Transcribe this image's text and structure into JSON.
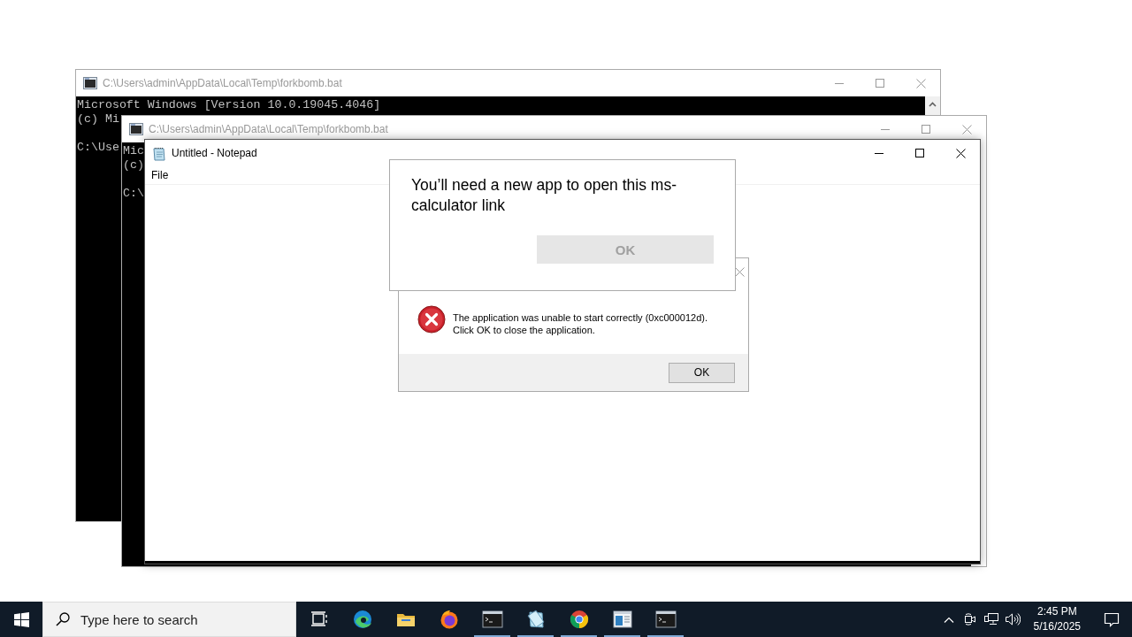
{
  "windows": [
    {
      "kind": "console",
      "title": "C:\\Users\\admin\\AppData\\Local\\Temp\\forkbomb.bat",
      "active": false,
      "lines": [
        "Microsoft Windows [Version 10.0.19045.4046]",
        "(c) Mi",
        "C:\\Use"
      ]
    },
    {
      "kind": "console",
      "title": "C:\\Users\\admin\\AppData\\Local\\Temp\\forkbomb.bat",
      "active": false,
      "lines": [
        "Mic",
        "(c)",
        "C:\\"
      ]
    },
    {
      "kind": "notepad",
      "title": "Untitled - Notepad",
      "active": true,
      "menu": [
        "File"
      ]
    },
    {
      "kind": "error_dialog",
      "message": "The application was unable to start correctly (0xc000012d).\nClick OK to close the application.",
      "button": "OK"
    },
    {
      "kind": "app_prompt",
      "message": "You’ll need a new app to open this ms-calculator link",
      "button": {
        "label": "OK",
        "disabled": true
      }
    }
  ],
  "taskbar": {
    "search": {
      "placeholder": "Type here to search"
    },
    "apps": [
      {
        "kind": "task_view",
        "running": false
      },
      {
        "kind": "edge",
        "running": false
      },
      {
        "kind": "explorer",
        "running": false
      },
      {
        "kind": "firefox",
        "running": false
      },
      {
        "kind": "console",
        "running": true
      },
      {
        "kind": "notepad",
        "running": true
      },
      {
        "kind": "chrome",
        "running": true
      },
      {
        "kind": "window",
        "running": true
      },
      {
        "kind": "console",
        "running": true
      }
    ],
    "clock": {
      "time": "2:45 PM",
      "date": "5/16/2025"
    }
  }
}
